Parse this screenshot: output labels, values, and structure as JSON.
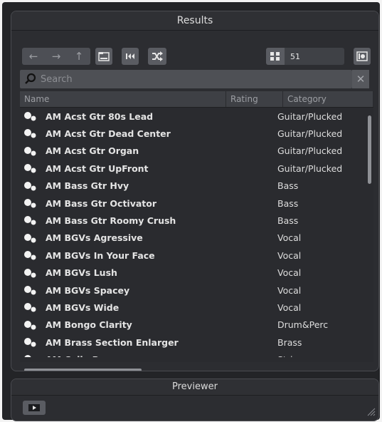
{
  "results": {
    "title": "Results"
  },
  "toolbar": {
    "back_icon": "arrow-left-icon",
    "forward_icon": "arrow-right-icon",
    "up_icon": "arrow-up-icon",
    "count": "51"
  },
  "search": {
    "placeholder": "Search",
    "value": ""
  },
  "table": {
    "columns": [
      "Name",
      "Rating",
      "Category"
    ],
    "rows": [
      {
        "name": "AM Acst Gtr 80s Lead",
        "category": "Guitar/Plucked"
      },
      {
        "name": "AM Acst Gtr Dead Center",
        "category": "Guitar/Plucked"
      },
      {
        "name": "AM Acst Gtr Organ",
        "category": "Guitar/Plucked"
      },
      {
        "name": "AM Acst Gtr UpFront",
        "category": "Guitar/Plucked"
      },
      {
        "name": "AM Bass Gtr Hvy",
        "category": "Bass"
      },
      {
        "name": "AM Bass Gtr Octivator",
        "category": "Bass"
      },
      {
        "name": "AM Bass Gtr Roomy Crush",
        "category": "Bass"
      },
      {
        "name": "AM BGVs Agressive",
        "category": "Vocal"
      },
      {
        "name": "AM BGVs In Your Face",
        "category": "Vocal"
      },
      {
        "name": "AM BGVs Lush",
        "category": "Vocal"
      },
      {
        "name": "AM BGVs Spacey",
        "category": "Vocal"
      },
      {
        "name": "AM BGVs Wide",
        "category": "Vocal"
      },
      {
        "name": "AM Bongo Clarity",
        "category": "Drum&Perc"
      },
      {
        "name": "AM Brass Section Enlarger",
        "category": "Brass"
      },
      {
        "name": "AM Cello Bow",
        "category": "Strings"
      }
    ]
  },
  "previewer": {
    "title": "Previewer"
  }
}
